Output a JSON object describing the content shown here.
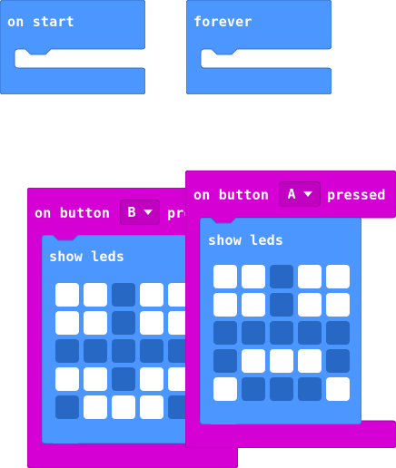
{
  "colors": {
    "basic": "#4c97ff",
    "basic_stroke": "#3373cc",
    "input": "#d400d4",
    "input_stroke": "#a300a3",
    "led_on": "#ffffff",
    "led_off": "#2768c4"
  },
  "blocks": {
    "on_start": {
      "label": "on start"
    },
    "forever": {
      "label": "forever"
    },
    "button_b": {
      "prefix": "on button",
      "button": "B",
      "suffix": "pressed",
      "inner_label": "show leds",
      "leds": [
        [
          1,
          1,
          0,
          1,
          1
        ],
        [
          1,
          1,
          0,
          1,
          1
        ],
        [
          0,
          0,
          0,
          0,
          0
        ],
        [
          1,
          1,
          0,
          1,
          1
        ],
        [
          0,
          1,
          1,
          1,
          0
        ]
      ]
    },
    "button_a": {
      "prefix": "on button",
      "button": "A",
      "suffix": "pressed",
      "inner_label": "show leds",
      "leds": [
        [
          1,
          1,
          0,
          1,
          1
        ],
        [
          1,
          1,
          0,
          1,
          1
        ],
        [
          0,
          0,
          0,
          0,
          0
        ],
        [
          0,
          1,
          1,
          1,
          0
        ],
        [
          1,
          0,
          0,
          0,
          1
        ]
      ]
    }
  }
}
